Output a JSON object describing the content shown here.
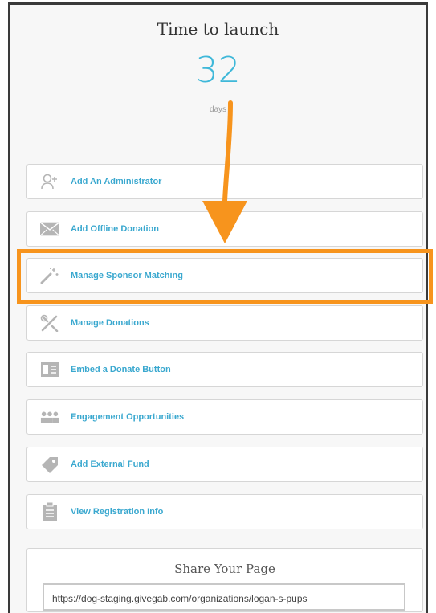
{
  "header": {
    "title": "Time to launch",
    "countdown_value": "32",
    "countdown_unit": "days"
  },
  "menu": {
    "items": [
      {
        "label": "Add An Administrator",
        "icon": "add-user-icon"
      },
      {
        "label": "Add Offline Donation",
        "icon": "envelope-icon"
      },
      {
        "label": "Manage Sponsor Matching",
        "icon": "magic-wand-icon",
        "highlighted": true
      },
      {
        "label": "Manage Donations",
        "icon": "tools-icon"
      },
      {
        "label": "Embed a Donate Button",
        "icon": "embed-icon"
      },
      {
        "label": "Engagement Opportunities",
        "icon": "group-icon"
      },
      {
        "label": "Add External Fund",
        "icon": "tag-icon"
      },
      {
        "label": "View Registration Info",
        "icon": "clipboard-icon"
      }
    ]
  },
  "share": {
    "title": "Share Your Page",
    "url": "https://dog-staging.givegab.com/organizations/logan-s-pups"
  },
  "colors": {
    "accent": "#3fb8d9",
    "link": "#3aa8cf",
    "highlight": "#f7941d",
    "icon_gray": "#b5b5b5"
  }
}
